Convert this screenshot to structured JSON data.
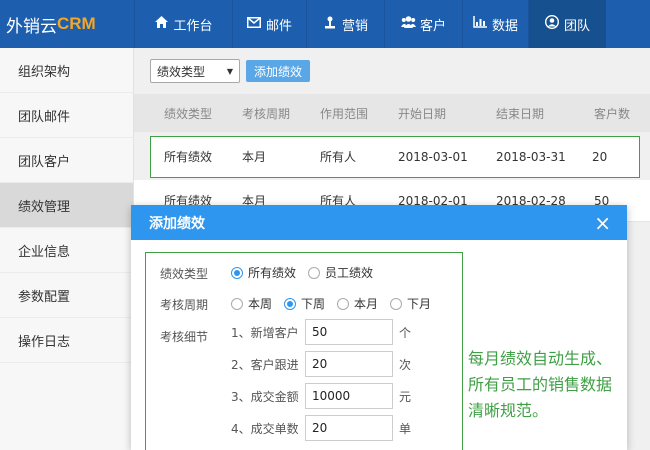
{
  "app": {
    "logo_text": "外销云",
    "logo_accent": "CRM",
    "accent_color": "#f5a623",
    "brand_color": "#1d5fae"
  },
  "nav": [
    {
      "label": "工作台",
      "icon": "home-icon"
    },
    {
      "label": "邮件",
      "icon": "mail-icon"
    },
    {
      "label": "营销",
      "icon": "marketing-icon"
    },
    {
      "label": "客户",
      "icon": "users-icon"
    },
    {
      "label": "数据",
      "icon": "chart-icon"
    },
    {
      "label": "团队",
      "icon": "user-circle-icon"
    }
  ],
  "sidebar": {
    "items": [
      {
        "label": "组织架构"
      },
      {
        "label": "团队邮件"
      },
      {
        "label": "团队客户"
      },
      {
        "label": "绩效管理"
      },
      {
        "label": "企业信息"
      },
      {
        "label": "参数配置"
      },
      {
        "label": "操作日志"
      }
    ],
    "active_index": 3
  },
  "toolbar": {
    "select_value": "绩效类型",
    "add_button": "添加绩效"
  },
  "table": {
    "headers": [
      "绩效类型",
      "考核周期",
      "作用范围",
      "开始日期",
      "结束日期",
      "客户数"
    ],
    "rows": [
      [
        "所有绩效",
        "本月",
        "所有人",
        "2018-03-01",
        "2018-03-31",
        "20"
      ],
      [
        "所有绩效",
        "本月",
        "所有人",
        "2018-02-01",
        "2018-02-28",
        "50"
      ]
    ]
  },
  "modal": {
    "title": "添加绩效",
    "close_symbol": "×",
    "type_label": "绩效类型",
    "type_options": [
      {
        "label": "所有绩效",
        "checked": true
      },
      {
        "label": "员工绩效",
        "checked": false
      }
    ],
    "period_label": "考核周期",
    "period_options": [
      {
        "label": "本周",
        "checked": false
      },
      {
        "label": "下周",
        "checked": true
      },
      {
        "label": "本月",
        "checked": false
      },
      {
        "label": "下月",
        "checked": false
      }
    ],
    "detail_label": "考核细节",
    "details": [
      {
        "label": "1、新增客户",
        "value": "50",
        "unit": "个"
      },
      {
        "label": "2、客户跟进",
        "value": "20",
        "unit": "次"
      },
      {
        "label": "3、成交金额",
        "value": "10000",
        "unit": "元"
      },
      {
        "label": "4、成交单数",
        "value": "20",
        "unit": "单"
      }
    ]
  },
  "annotation": {
    "line1": "每月绩效自动生成、",
    "line2": "所有员工的销售数据",
    "line3": "清晰规范。"
  }
}
